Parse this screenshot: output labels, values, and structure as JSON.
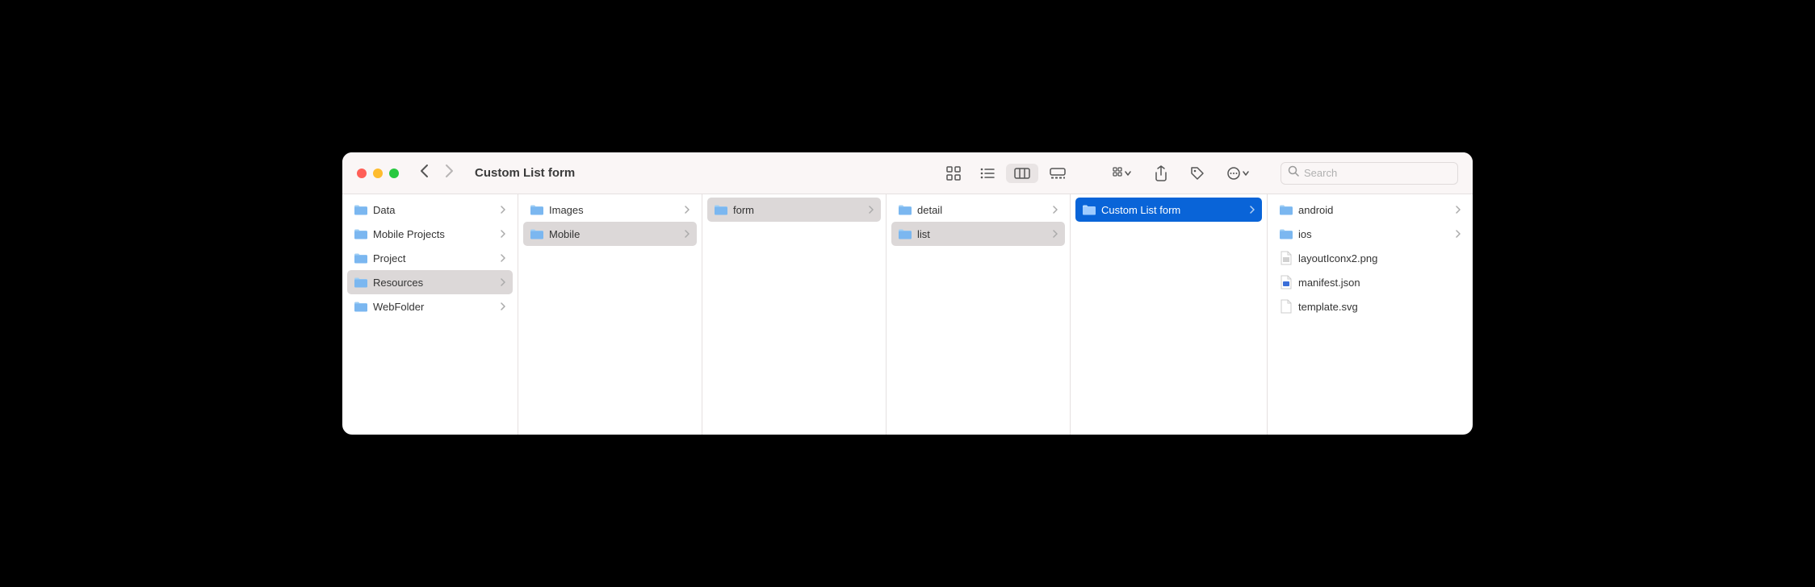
{
  "window": {
    "title": "Custom List form"
  },
  "search": {
    "placeholder": "Search"
  },
  "columns": [
    {
      "items": [
        {
          "label": "Data",
          "type": "folder",
          "state": "normal",
          "hasChildren": true
        },
        {
          "label": "Mobile Projects",
          "type": "folder",
          "state": "normal",
          "hasChildren": true
        },
        {
          "label": "Project",
          "type": "folder",
          "state": "normal",
          "hasChildren": true
        },
        {
          "label": "Resources",
          "type": "folder",
          "state": "path",
          "hasChildren": true
        },
        {
          "label": "WebFolder",
          "type": "folder",
          "state": "normal",
          "hasChildren": true
        }
      ]
    },
    {
      "items": [
        {
          "label": "Images",
          "type": "folder",
          "state": "normal",
          "hasChildren": true
        },
        {
          "label": "Mobile",
          "type": "folder",
          "state": "path",
          "hasChildren": true
        }
      ]
    },
    {
      "items": [
        {
          "label": "form",
          "type": "folder",
          "state": "path",
          "hasChildren": true
        }
      ]
    },
    {
      "items": [
        {
          "label": "detail",
          "type": "folder",
          "state": "normal",
          "hasChildren": true
        },
        {
          "label": "list",
          "type": "folder",
          "state": "path",
          "hasChildren": true
        }
      ]
    },
    {
      "items": [
        {
          "label": "Custom List form",
          "type": "folder",
          "state": "selected",
          "hasChildren": true
        }
      ]
    },
    {
      "items": [
        {
          "label": "android",
          "type": "folder",
          "state": "normal",
          "hasChildren": true
        },
        {
          "label": "ios",
          "type": "folder",
          "state": "normal",
          "hasChildren": true
        },
        {
          "label": "layoutIconx2.png",
          "type": "png",
          "state": "normal",
          "hasChildren": false
        },
        {
          "label": "manifest.json",
          "type": "json",
          "state": "normal",
          "hasChildren": false
        },
        {
          "label": "template.svg",
          "type": "svg",
          "state": "normal",
          "hasChildren": false
        }
      ]
    }
  ]
}
